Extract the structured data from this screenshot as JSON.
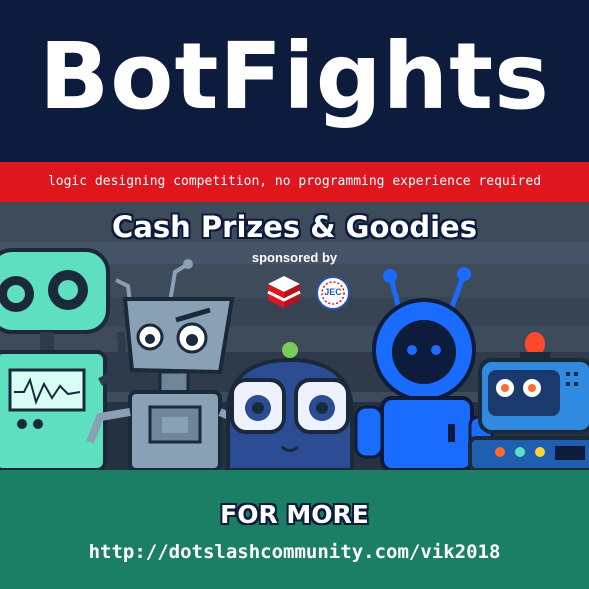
{
  "title": "BotFights",
  "tagline": "logic designing competition, no programming experience required",
  "prizes": "Cash  Prizes & Goodies",
  "sponsored_by": "sponsored by",
  "sponsor_logos": [
    "stacked-cube-logo",
    "jec-seal-logo"
  ],
  "sponsor_jec_text": "JEC",
  "robots": [
    "green-robot",
    "grey-angry-robot",
    "white-eyes-robot",
    "blue-antenna-robot",
    "blue-siren-robot"
  ],
  "cta": "FOR MORE",
  "url": "http://dotslashcommunity.com/vik2018",
  "colors": {
    "navy": "#0d1b3d",
    "red": "#e0161e",
    "slate": "#3e4b5a",
    "green": "#1b7f65",
    "robot_green": "#5ee0c0",
    "robot_grey": "#8aa0b4",
    "robot_blue": "#1a6cff"
  }
}
